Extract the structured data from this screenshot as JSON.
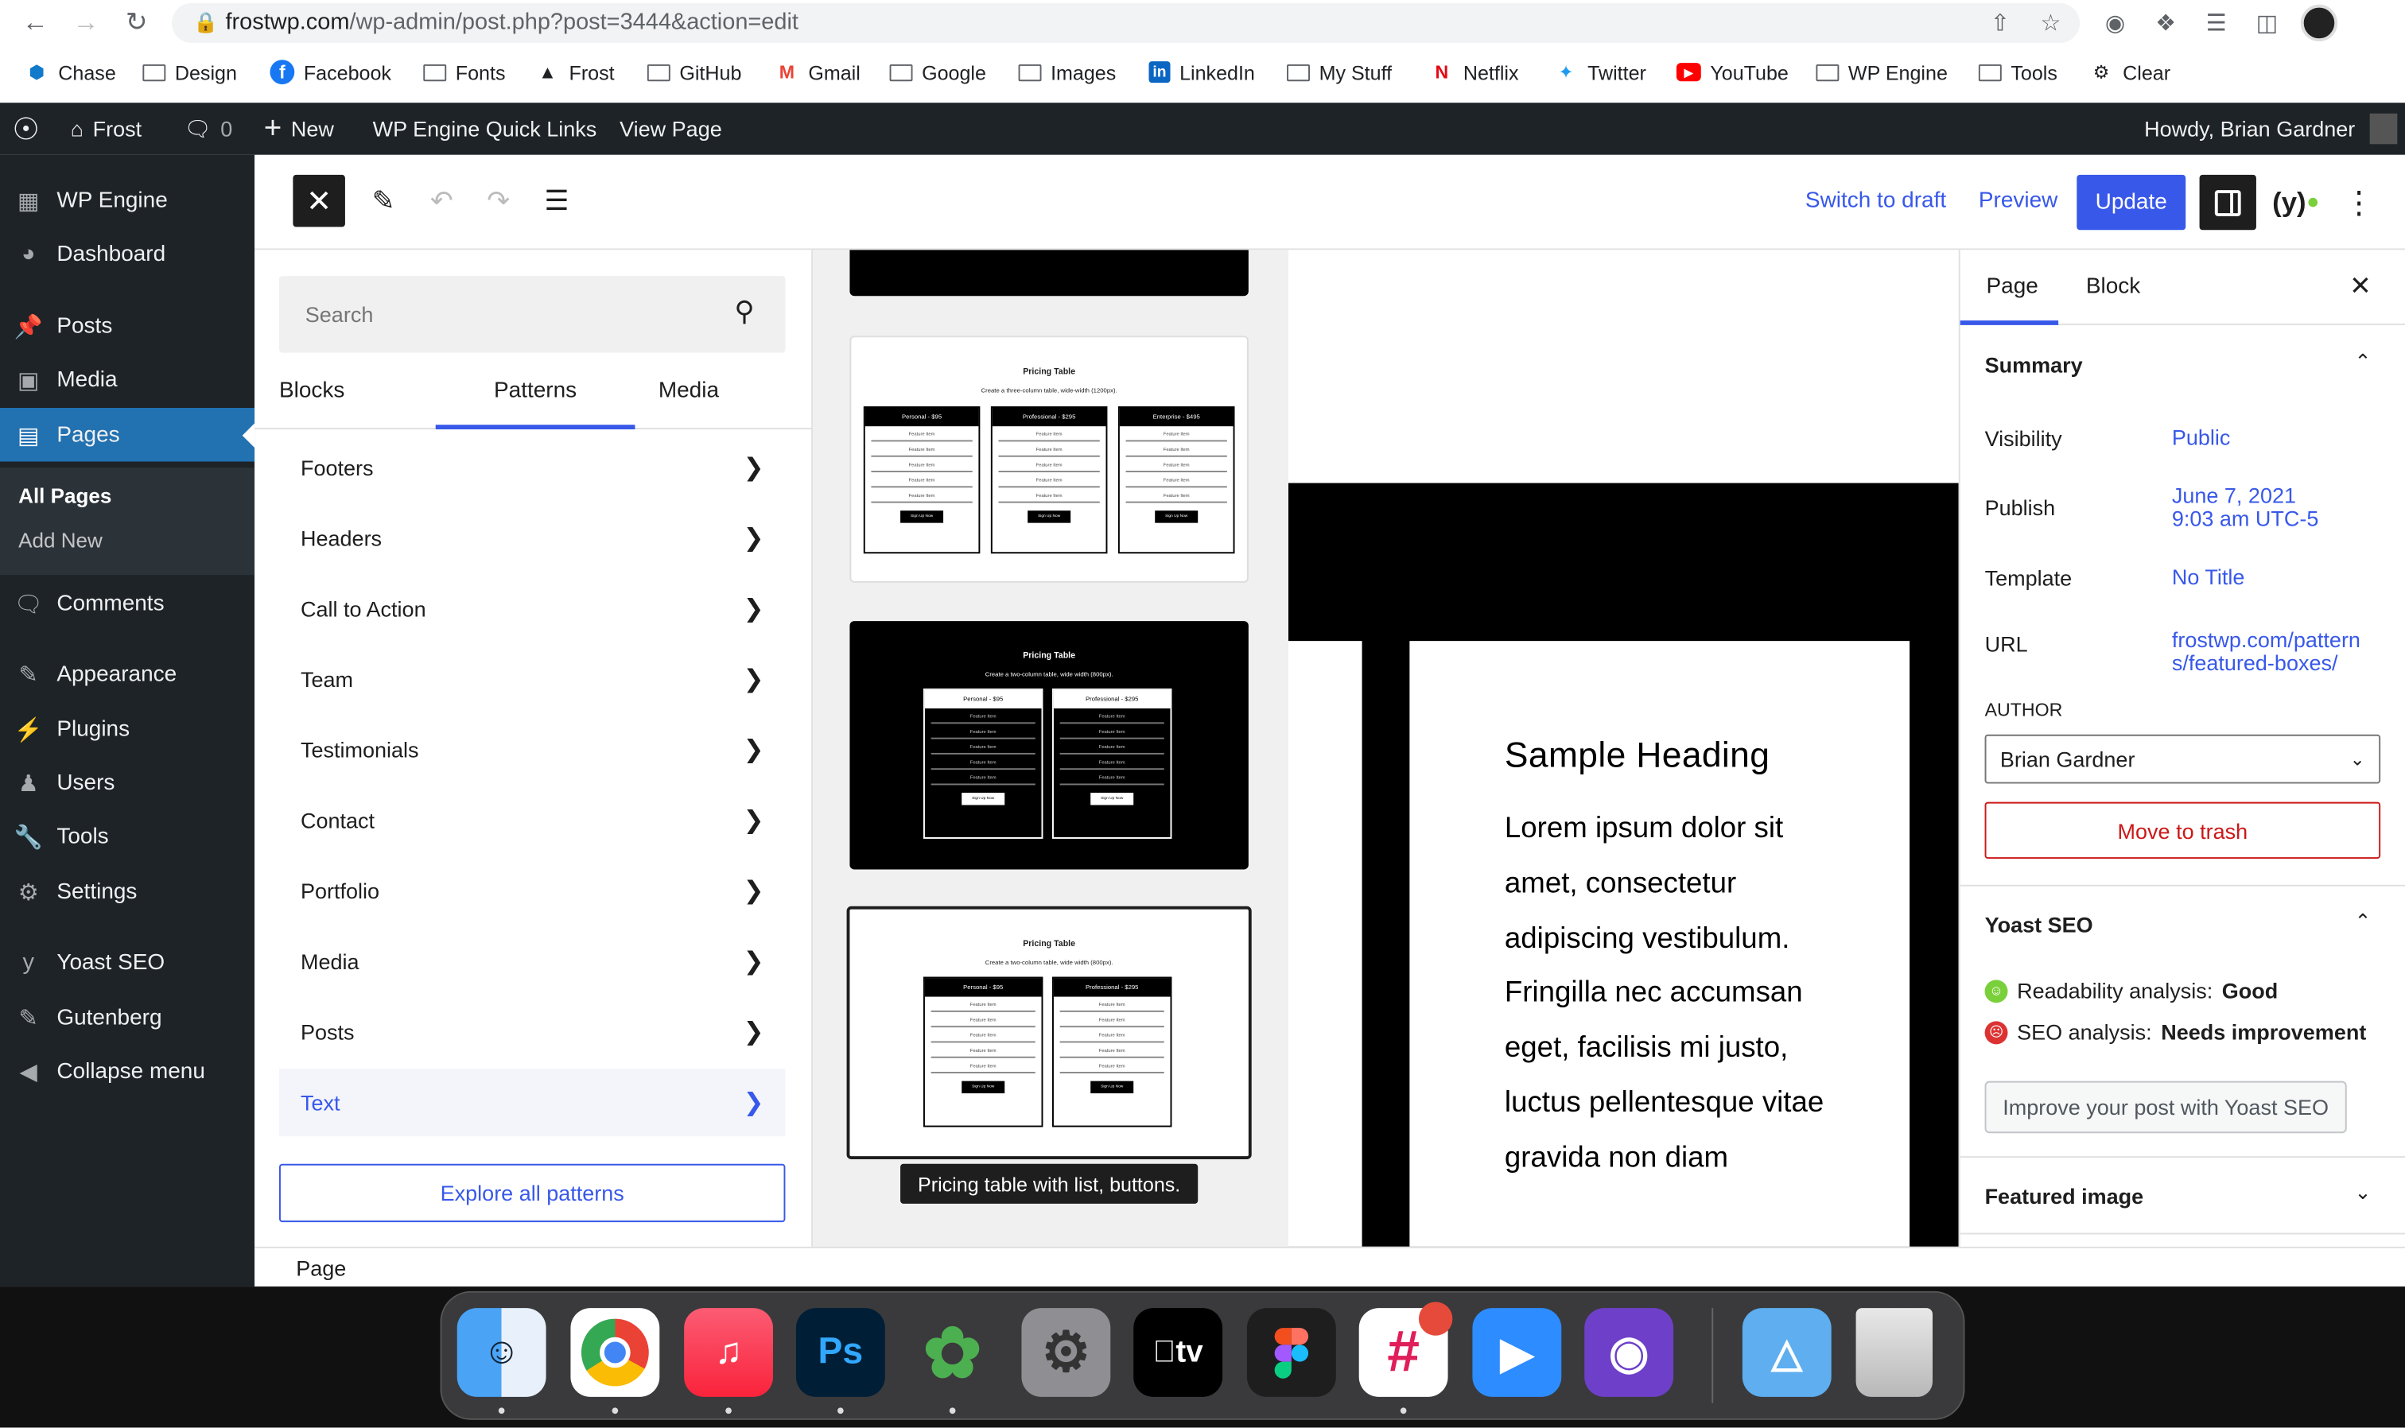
{
  "browser": {
    "url_host": "frostwp.com",
    "url_path": "/wp-admin/post.php?post=3444&action=edit",
    "bookmarks": [
      "Chase",
      "Design",
      "Facebook",
      "Fonts",
      "Frost",
      "GitHub",
      "Gmail",
      "Google",
      "Images",
      "LinkedIn",
      "My Stuff",
      "Netflix",
      "Twitter",
      "YouTube",
      "WP Engine",
      "Tools",
      "Clear"
    ]
  },
  "adminbar": {
    "site": "Frost",
    "comments_count": "0",
    "new_label": "New",
    "quick_links": "WP Engine Quick Links",
    "view_page": "View Page",
    "howdy": "Howdy, Brian Gardner"
  },
  "sidebar": {
    "items": [
      "WP Engine",
      "Dashboard",
      "Posts",
      "Media",
      "Pages",
      "Comments",
      "Appearance",
      "Plugins",
      "Users",
      "Tools",
      "Settings",
      "Yoast SEO",
      "Gutenberg",
      "Collapse menu"
    ],
    "submenu": [
      "All Pages",
      "Add New"
    ]
  },
  "header": {
    "switch_draft": "Switch to draft",
    "preview": "Preview",
    "update": "Update"
  },
  "inserter": {
    "search_placeholder": "Search",
    "tabs": [
      "Blocks",
      "Patterns",
      "Media"
    ],
    "categories": [
      "Footers",
      "Headers",
      "Call to Action",
      "Team",
      "Testimonials",
      "Contact",
      "Portfolio",
      "Media",
      "Posts",
      "Text"
    ],
    "selected_category": "Text",
    "explore": "Explore all patterns"
  },
  "previews": {
    "title": "Pricing Table",
    "sub3": "Create a three-column table, wide-width (1200px).",
    "sub2": "Create a two-column table, wide width (800px).",
    "col_personal": "Personal - $95",
    "col_professional": "Professional - $295",
    "col_enterprise": "Enterprise - $495",
    "feature": "Feature Item",
    "button": "Sign Up Now",
    "tooltip": "Pricing table with list, buttons."
  },
  "canvas": {
    "heading": "Sample Heading",
    "body": "Lorem ipsum dolor sit amet, consectetur adipiscing vestibulum. Fringilla nec accumsan eget, facilisis mi justo, luctus pellentesque vitae gravida non diam"
  },
  "settings": {
    "tabs": [
      "Page",
      "Block"
    ],
    "summary": "Summary",
    "visibility_label": "Visibility",
    "visibility_value": "Public",
    "publish_label": "Publish",
    "publish_date": "June 7, 2021",
    "publish_time": "9:03 am UTC-5",
    "template_label": "Template",
    "template_value": "No Title",
    "url_label": "URL",
    "url_line1": "frostwp.com/pattern",
    "url_line2": "s/featured-boxes/",
    "author_label": "AUTHOR",
    "author_value": "Brian Gardner",
    "trash": "Move to trash",
    "yoast": "Yoast SEO",
    "readability_label": "Readability analysis:",
    "readability_value": "Good",
    "seo_label": "SEO analysis:",
    "seo_value": "Needs improvement",
    "improve": "Improve your post with Yoast SEO",
    "featured_image": "Featured image"
  },
  "footer": {
    "breadcrumb": "Page"
  },
  "colors": {
    "accent": "#3858e9",
    "admin": "#1d2327",
    "admin_active": "#2271b1",
    "danger": "#cc1818"
  }
}
